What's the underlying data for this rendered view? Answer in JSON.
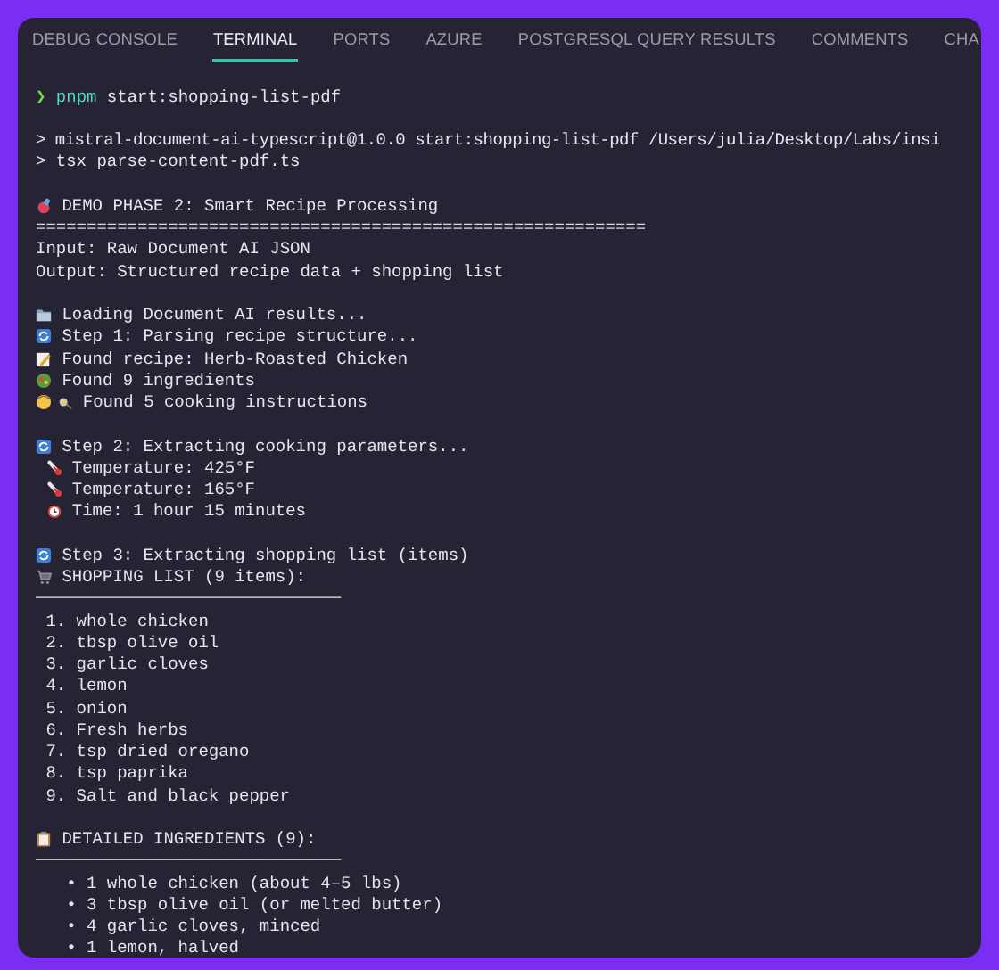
{
  "tabs": [
    {
      "label": "DEBUG CONSOLE",
      "selected": false
    },
    {
      "label": "TERMINAL",
      "selected": true
    },
    {
      "label": "PORTS",
      "selected": false
    },
    {
      "label": "AZURE",
      "selected": false
    },
    {
      "label": "POSTGRESQL QUERY RESULTS",
      "selected": false
    },
    {
      "label": "COMMENTS",
      "selected": false
    },
    {
      "label": "CHA",
      "selected": false
    }
  ],
  "terminal": {
    "lines": [
      {
        "kind": "prompt",
        "symbol": "❯",
        "program": "pnpm",
        "text": "start:shopping-list-pdf"
      },
      {
        "kind": "blank"
      },
      {
        "kind": "command",
        "text": "> mistral-document-ai-typescript@1.0.0 start:shopping-list-pdf /Users/julia/Desktop/Labs/insi"
      },
      {
        "kind": "text",
        "text": "> tsx parse-content-pdf.ts"
      },
      {
        "kind": "blank"
      },
      {
        "kind": "phase",
        "text": "DEMO PHASE 2: Smart Recipe Processing"
      },
      {
        "kind": "rule",
        "text": "============================================================"
      },
      {
        "kind": "text",
        "text": "Input: Raw Document AI JSON"
      },
      {
        "kind": "text",
        "text": "Output: Structured recipe data + shopping list"
      },
      {
        "kind": "blank"
      },
      {
        "kind": "loading",
        "text": "Loading Document AI results..."
      },
      {
        "kind": "step",
        "text": "Step 1: Parsing recipe structure..."
      },
      {
        "kind": "recipe",
        "text": "Found recipe: Herb-Roasted Chicken"
      },
      {
        "kind": "ingredients",
        "text": "Found 9 ingredients"
      },
      {
        "kind": "instructions",
        "text": "Found 5 cooking instructions"
      },
      {
        "kind": "blank"
      },
      {
        "kind": "step",
        "text": "Step 2: Extracting cooking parameters..."
      },
      {
        "kind": "temperature",
        "text": "Temperature: 425°F"
      },
      {
        "kind": "temperature",
        "text": "Temperature: 165°F"
      },
      {
        "kind": "time",
        "text": "Time: 1 hour 15 minutes"
      },
      {
        "kind": "blank"
      },
      {
        "kind": "step",
        "text": "Step 3: Extracting shopping list (items)"
      },
      {
        "kind": "cart",
        "text": "SHOPPING LIST (9 items):"
      },
      {
        "kind": "rule",
        "text": "──────────────────────────────"
      },
      {
        "kind": "numbered",
        "text": "1. whole chicken"
      },
      {
        "kind": "numbered",
        "text": "2. tbsp olive oil"
      },
      {
        "kind": "numbered",
        "text": "3. garlic cloves"
      },
      {
        "kind": "numbered",
        "text": "4. lemon"
      },
      {
        "kind": "numbered",
        "text": "5. onion"
      },
      {
        "kind": "numbered",
        "text": "6. Fresh herbs"
      },
      {
        "kind": "numbered",
        "text": "7. tsp dried oregano"
      },
      {
        "kind": "numbered",
        "text": "8. tsp paprika"
      },
      {
        "kind": "numbered",
        "text": "9. Salt and black pepper"
      },
      {
        "kind": "blank"
      },
      {
        "kind": "clipboard",
        "text": "DETAILED INGREDIENTS (9):"
      },
      {
        "kind": "rule",
        "text": "──────────────────────────────"
      },
      {
        "kind": "bullet",
        "text": "• 1 whole chicken (about 4–5 lbs)"
      },
      {
        "kind": "bullet",
        "text": "• 3 tbsp olive oil (or melted butter)"
      },
      {
        "kind": "bullet",
        "text": "• 4 garlic cloves, minced"
      },
      {
        "kind": "bullet",
        "text": "• 1 lemon, halved"
      }
    ]
  }
}
